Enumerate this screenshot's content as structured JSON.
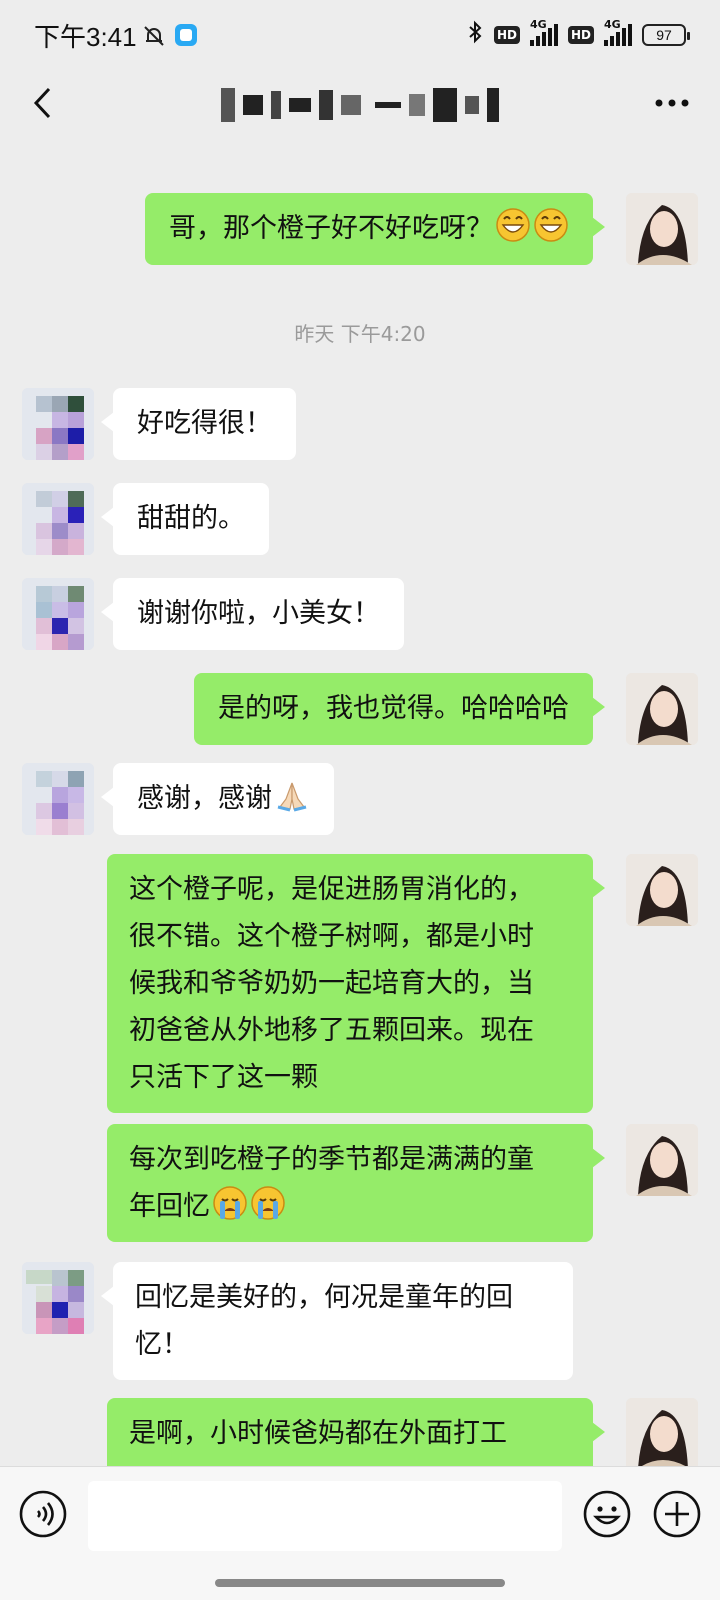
{
  "status_bar": {
    "time": "下午3:41",
    "net1": "4G",
    "net2": "4G",
    "hd1": "HD",
    "hd2": "HD",
    "battery": "97"
  },
  "header": {
    "title": "",
    "back_icon": "chevron-left-icon",
    "more_icon": "more-dots-icon"
  },
  "messages": [
    {
      "side": "me",
      "text": "哥，那个橙子好不好吃呀？",
      "emojis": [
        "grin",
        "grin"
      ]
    },
    {
      "type": "time",
      "text": "昨天 下午4:20"
    },
    {
      "side": "peer",
      "text": "好吃得很！"
    },
    {
      "side": "peer",
      "text": "甜甜的。"
    },
    {
      "side": "peer",
      "text": "谢谢你啦，小美女！"
    },
    {
      "side": "me",
      "text": "是的呀，我也觉得。哈哈哈哈"
    },
    {
      "side": "peer",
      "text": "感谢，感谢",
      "emojis": [
        "pray"
      ]
    },
    {
      "side": "me",
      "lines": [
        "这个橙子呢，是促进肠胃消化的，",
        "很不错。这个橙子树啊，都是小时",
        "候我和爷爷奶奶一起培育大的，当",
        "初爸爸从外地移了五颗回来。现在",
        "只活下了这一颗"
      ]
    },
    {
      "side": "me",
      "lines": [
        "每次到吃橙子的季节都是满满的童",
        "年回忆"
      ],
      "emojis": [
        "cry",
        "cry"
      ]
    },
    {
      "side": "peer",
      "lines": [
        "回忆是美好的，何况是童年的回",
        "忆！"
      ]
    },
    {
      "side": "me",
      "text": "是啊，小时候爸妈都在外面打工"
    }
  ],
  "colors": {
    "background": "#ededed",
    "my_bubble": "#95ec69",
    "peer_bubble": "#ffffff",
    "timestamp": "#9a9a9a"
  }
}
